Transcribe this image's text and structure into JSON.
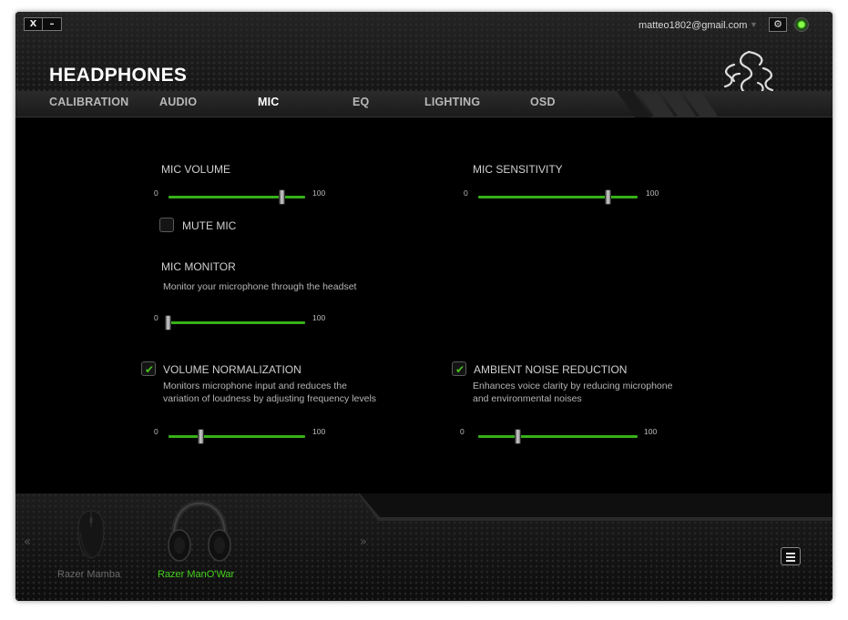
{
  "window_controls": {
    "close": "X",
    "minimize": "–"
  },
  "account": {
    "email": "matteo1802@gmail.com",
    "caret": "▼",
    "settings_icon": "gear-icon",
    "status": "online"
  },
  "page": {
    "title": "HEADPHONES"
  },
  "tabs": [
    {
      "label": "CALIBRATION",
      "active": false
    },
    {
      "label": "AUDIO",
      "active": false
    },
    {
      "label": "MIC",
      "active": true
    },
    {
      "label": "EQ",
      "active": false
    },
    {
      "label": "LIGHTING",
      "active": false
    },
    {
      "label": "OSD",
      "active": false
    }
  ],
  "mic": {
    "volume": {
      "label": "MIC VOLUME",
      "min": "0",
      "max": "100",
      "value": 84
    },
    "sensitivity": {
      "label": "MIC SENSITIVITY",
      "min": "0",
      "max": "100",
      "value": 82
    },
    "mute": {
      "label": "MUTE MIC",
      "checked": false
    },
    "monitor": {
      "label": "MIC MONITOR",
      "description": "Monitor your microphone through the headset",
      "min": "0",
      "max": "100",
      "value": 0
    },
    "normalization": {
      "label": "VOLUME NORMALIZATION",
      "checked": true,
      "description_line1": "Monitors microphone input and reduces the",
      "description_line2": "variation of loudness by adjusting frequency levels",
      "min": "0",
      "max": "100",
      "value": 24
    },
    "noise_reduction": {
      "label": "AMBIENT NOISE REDUCTION",
      "checked": true,
      "description_line1": "Enhances voice clarity by reducing microphone",
      "description_line2": "and environmental noises",
      "min": "0",
      "max": "100",
      "value": 25
    }
  },
  "devices": [
    {
      "name": "Razer Mamba",
      "active": false
    },
    {
      "name": "Razer ManO'War",
      "active": true
    }
  ],
  "footer": {
    "prev_arrow": "«",
    "next_arrow": "»"
  },
  "colors": {
    "accent": "#37b118",
    "active_device": "#44d11c",
    "inactive_device": "#6a6a6a"
  }
}
